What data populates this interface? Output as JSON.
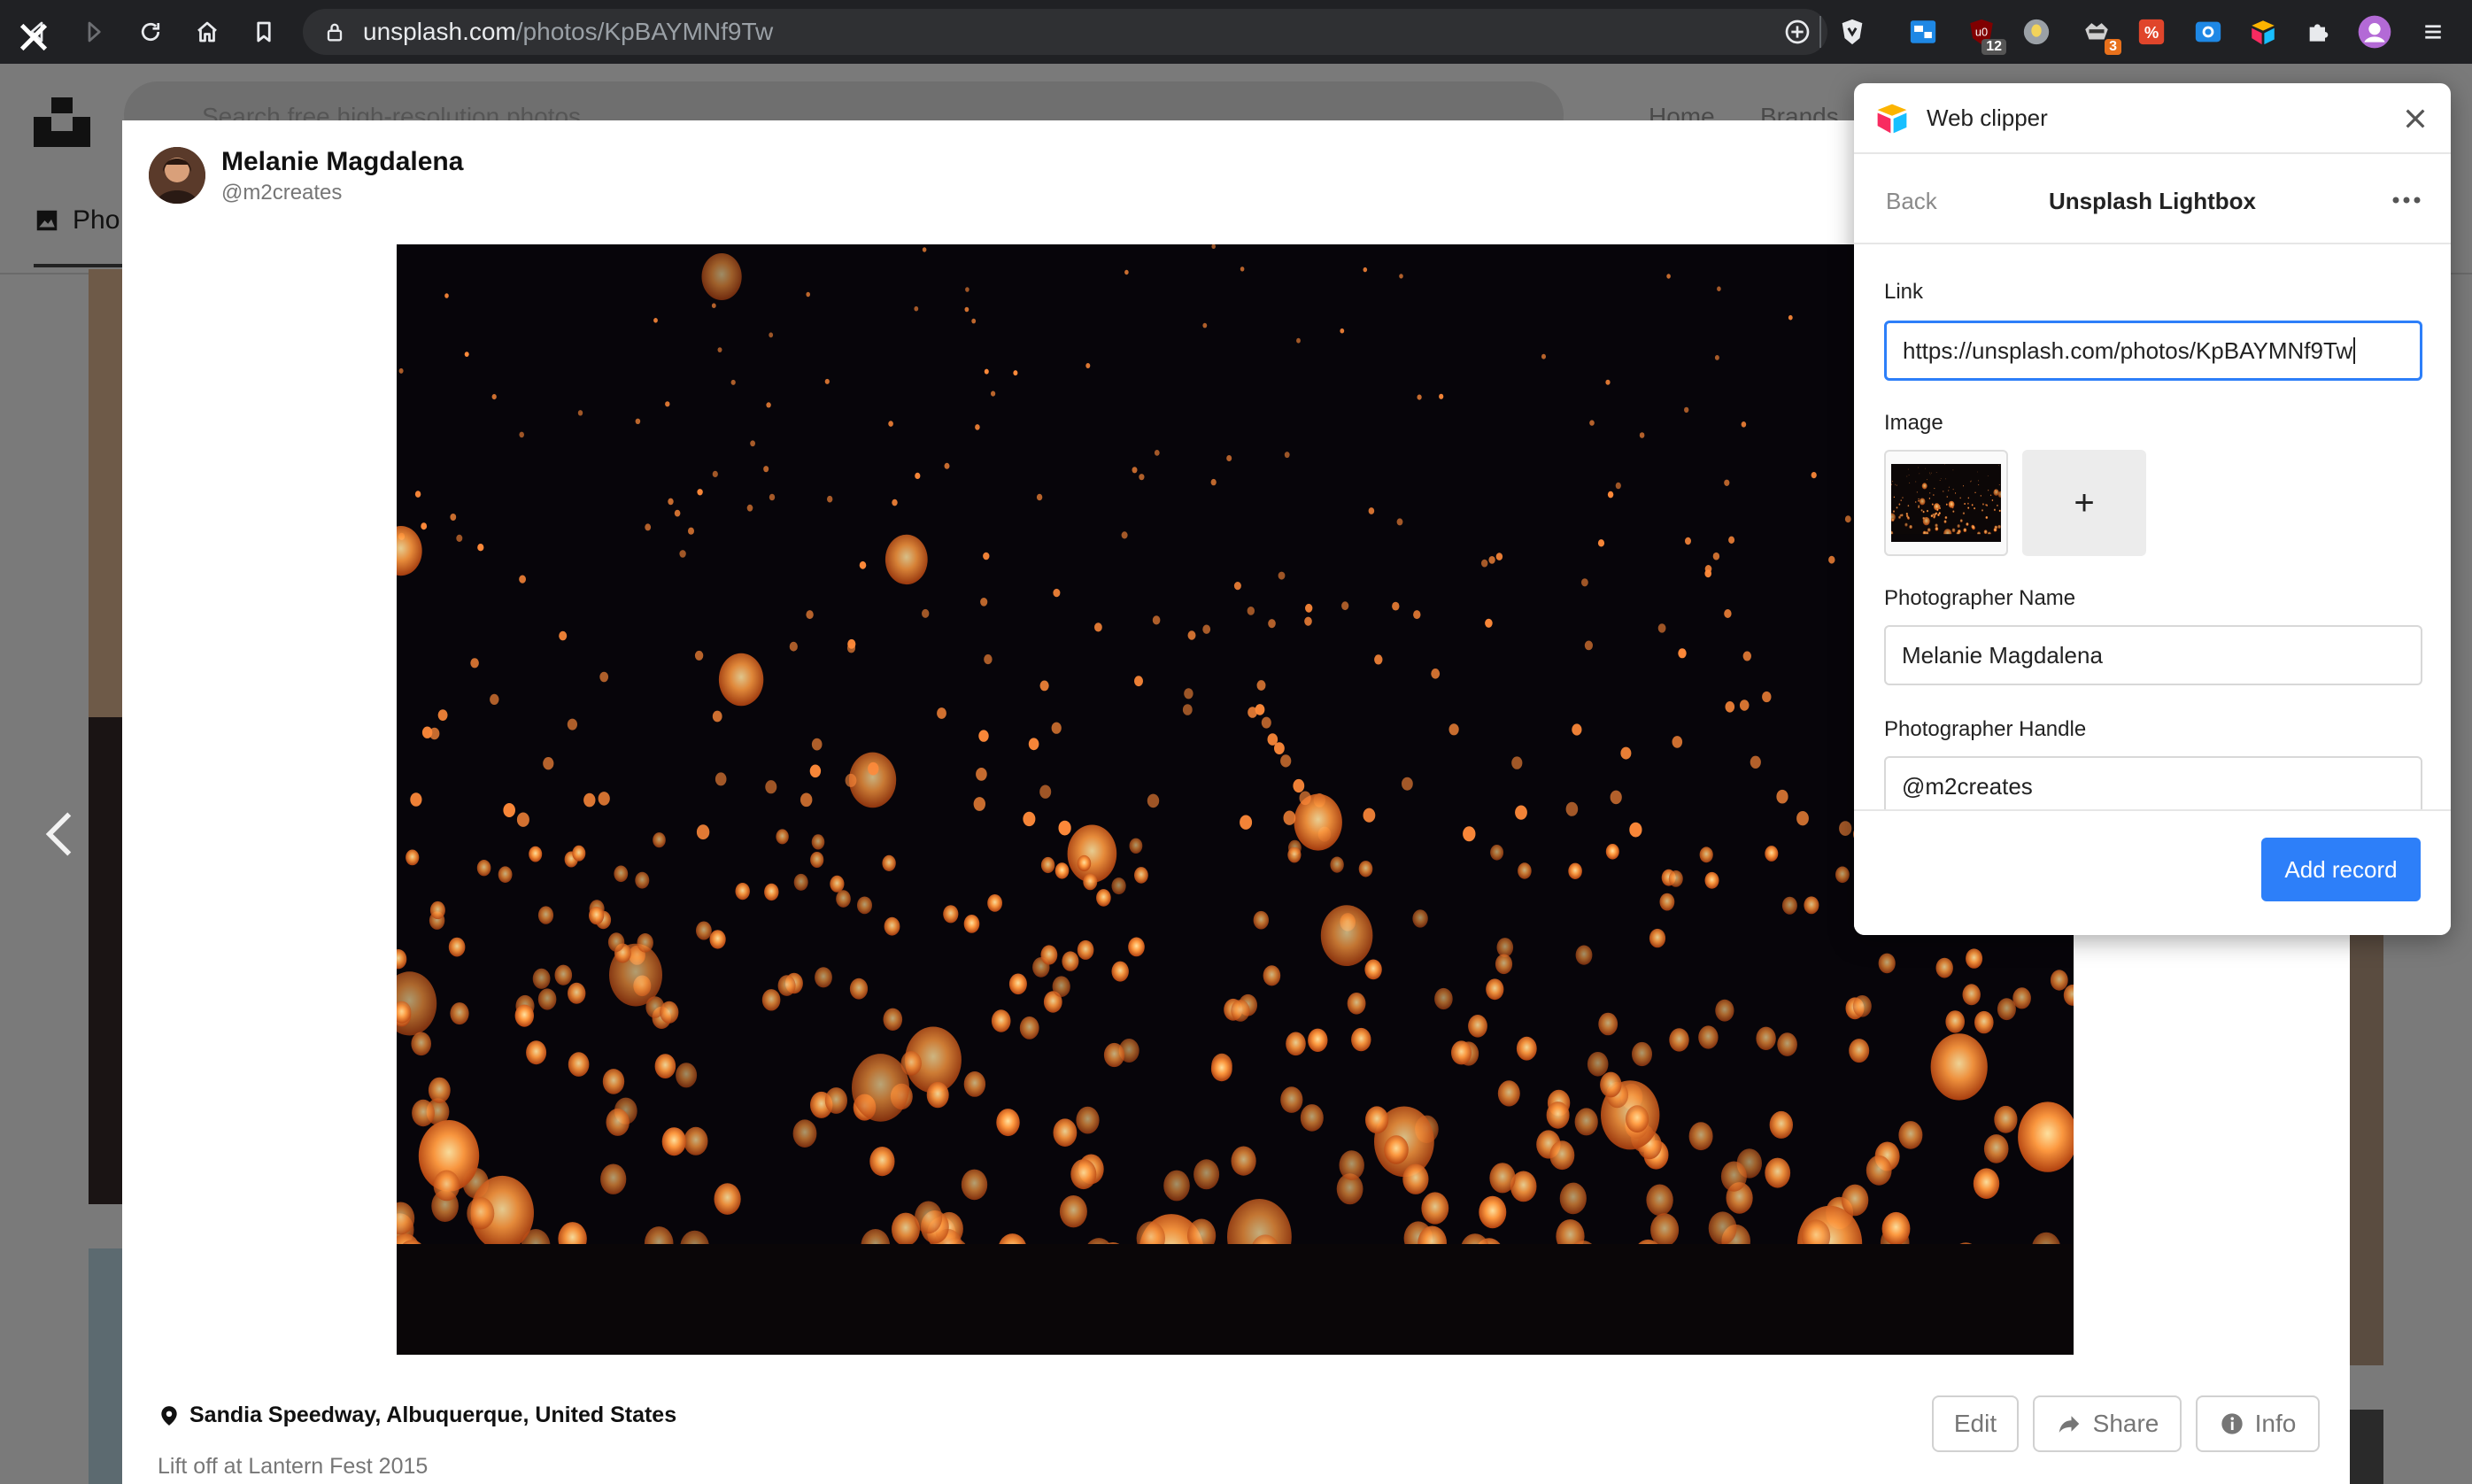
{
  "browser": {
    "url_host": "unsplash.com",
    "url_path": "/photos/KpBAYMNf9Tw",
    "extensions": [
      {
        "icon": "window-manager-icon",
        "badge": ""
      },
      {
        "icon": "ublock-icon",
        "badge": "12"
      },
      {
        "icon": "bulb-icon",
        "badge": ""
      },
      {
        "icon": "raccoon-icon",
        "badge": "3"
      },
      {
        "icon": "translate-icon",
        "badge": ""
      },
      {
        "icon": "screenshot-icon",
        "badge": ""
      },
      {
        "icon": "airtable-icon",
        "badge": ""
      },
      {
        "icon": "puzzle-icon",
        "badge": ""
      },
      {
        "icon": "profile-avatar-icon",
        "badge": ""
      },
      {
        "icon": "menu-icon",
        "badge": ""
      }
    ]
  },
  "page": {
    "search_placeholder": "Search free high-resolution photos",
    "nav_home": "Home",
    "nav_brands": "Brands",
    "tab_photos": "Pho"
  },
  "photo": {
    "author_name": "Melanie Magdalena",
    "author_handle": "@m2creates",
    "location": "Sandia Speedway, Albuquerque, United States",
    "caption": "Lift off at Lantern Fest 2015",
    "buttons": {
      "edit": "Edit",
      "share": "Share",
      "info": "Info"
    }
  },
  "clipper": {
    "title": "Web clipper",
    "back": "Back",
    "base_name": "Unsplash Lightbox",
    "fields": {
      "link_label": "Link",
      "link_value": "https://unsplash.com/photos/KpBAYMNf9Tw",
      "image_label": "Image",
      "image_add": "+",
      "photographer_name_label": "Photographer Name",
      "photographer_name_value": "Melanie Magdalena",
      "photographer_handle_label": "Photographer Handle",
      "photographer_handle_value": "@m2creates"
    },
    "add_record": "Add record"
  },
  "colors": {
    "accent": "#2d7ff9",
    "chrome": "#202124"
  }
}
